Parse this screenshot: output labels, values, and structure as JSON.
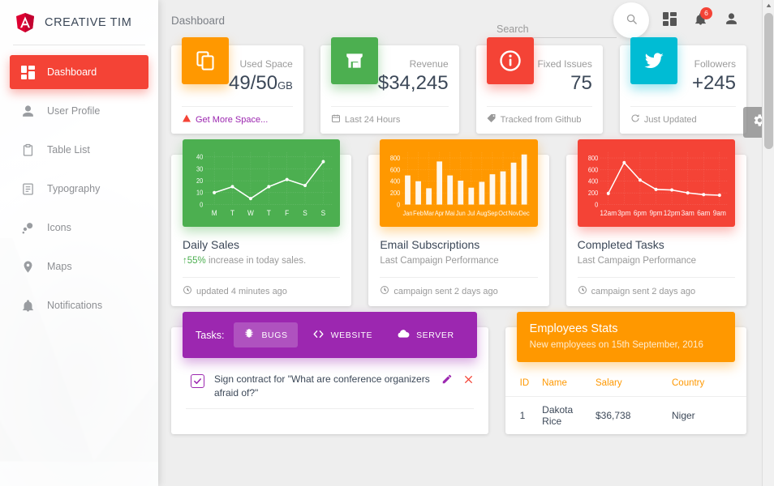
{
  "brand": {
    "name": "CREATIVE TIM",
    "logo_icon": "angular-logo-icon"
  },
  "sidebar": {
    "items": [
      {
        "label": "Dashboard",
        "icon": "dashboard-grid-icon",
        "active": true
      },
      {
        "label": "User Profile",
        "icon": "person-icon",
        "active": false
      },
      {
        "label": "Table List",
        "icon": "clipboard-icon",
        "active": false
      },
      {
        "label": "Typography",
        "icon": "text-document-icon",
        "active": false
      },
      {
        "label": "Icons",
        "icon": "bubbles-icon",
        "active": false
      },
      {
        "label": "Maps",
        "icon": "map-pin-icon",
        "active": false
      },
      {
        "label": "Notifications",
        "icon": "bell-icon",
        "active": false
      }
    ]
  },
  "topbar": {
    "title": "Dashboard",
    "search": {
      "placeholder": "Search",
      "value": ""
    },
    "search_button_icon": "search-icon",
    "dashboard_icon": "dashboard-grid-icon",
    "notifications_icon": "bell-icon",
    "notifications_count": "6",
    "profile_icon": "person-icon"
  },
  "settings_tab": {
    "icon": "gear-icon"
  },
  "stats": [
    {
      "label": "Used Space",
      "value": "49/50",
      "unit": "GB",
      "icon": "copy-layers-icon",
      "color": "#ff9800",
      "footer_text": "Get More Space...",
      "footer_icon": "warning-triangle-icon",
      "footer_is_link": true
    },
    {
      "label": "Revenue",
      "value": "$34,245",
      "unit": "",
      "icon": "store-icon",
      "color": "#4caf50",
      "footer_text": "Last 24 Hours",
      "footer_icon": "calendar-icon",
      "footer_is_link": false
    },
    {
      "label": "Fixed Issues",
      "value": "75",
      "unit": "",
      "icon": "info-circle-icon",
      "color": "#f44336",
      "footer_text": "Tracked from Github",
      "footer_icon": "tag-icon",
      "footer_is_link": false
    },
    {
      "label": "Followers",
      "value": "+245",
      "unit": "",
      "icon": "twitter-bird-icon",
      "color": "#00bcd4",
      "footer_text": "Just Updated",
      "footer_icon": "refresh-icon",
      "footer_is_link": false
    }
  ],
  "charts": [
    {
      "title": "Daily Sales",
      "subtitle_highlight": "55%",
      "subtitle": " increase in today sales.",
      "subtitle_icon": "arrow-up-icon",
      "footer_text": "updated 4 minutes ago",
      "footer_icon": "clock-icon",
      "color": "#4caf50"
    },
    {
      "title": "Email Subscriptions",
      "subtitle_highlight": "",
      "subtitle": "Last Campaign Performance",
      "subtitle_icon": "",
      "footer_text": "campaign sent 2 days ago",
      "footer_icon": "clock-icon",
      "color": "#ff9800"
    },
    {
      "title": "Completed Tasks",
      "subtitle_highlight": "",
      "subtitle": "Last Campaign Performance",
      "subtitle_icon": "",
      "footer_text": "campaign sent 2 days ago",
      "footer_icon": "clock-icon",
      "color": "#f44336"
    }
  ],
  "chart_data": [
    {
      "type": "line",
      "title": "Daily Sales",
      "categories": [
        "M",
        "T",
        "W",
        "T",
        "F",
        "S",
        "S"
      ],
      "values": [
        10,
        15,
        5,
        15,
        21,
        16,
        36
      ],
      "yticks": [
        0,
        10,
        20,
        30,
        40
      ],
      "ylim": [
        0,
        44
      ],
      "xlabel": "",
      "ylabel": "",
      "grid": true,
      "legend": "none",
      "color": "#ffffff",
      "background": "#4caf50"
    },
    {
      "type": "bar",
      "title": "Email Subscriptions",
      "categories": [
        "Jan",
        "Feb",
        "Mar",
        "Apr",
        "Mai",
        "Jun",
        "Jul",
        "Aug",
        "Sep",
        "Oct",
        "Nov",
        "Dec"
      ],
      "values": [
        500,
        400,
        280,
        740,
        500,
        410,
        290,
        390,
        520,
        570,
        720,
        860
      ],
      "yticks": [
        0,
        200,
        400,
        600,
        800
      ],
      "ylim": [
        0,
        900
      ],
      "xlabel": "",
      "ylabel": "",
      "grid": true,
      "legend": "none",
      "color": "#ffffff",
      "background": "#ff9800"
    },
    {
      "type": "line",
      "title": "Completed Tasks",
      "categories": [
        "12am",
        "3pm",
        "6pm",
        "9pm",
        "12pm",
        "3am",
        "6am",
        "9am"
      ],
      "values": [
        190,
        720,
        420,
        260,
        250,
        200,
        170,
        160
      ],
      "yticks": [
        0,
        200,
        400,
        600,
        800
      ],
      "ylim": [
        0,
        900
      ],
      "xlabel": "",
      "ylabel": "",
      "grid": true,
      "legend": "none",
      "color": "#ffffff",
      "background": "#f44336"
    }
  ],
  "tasks_card": {
    "label": "Tasks:",
    "tabs": [
      {
        "label": "BUGS",
        "icon": "bug-icon",
        "active": true
      },
      {
        "label": "WEBSITE",
        "icon": "code-icon",
        "active": false
      },
      {
        "label": "SERVER",
        "icon": "cloud-icon",
        "active": false
      }
    ],
    "rows": [
      {
        "text": "Sign contract for \"What are conference organizers afraid of?\"",
        "checked": true,
        "edit_icon": "pencil-icon",
        "delete_icon": "close-icon"
      }
    ]
  },
  "employees_card": {
    "title": "Employees Stats",
    "subtitle": "New employees on 15th September, 2016",
    "columns": [
      "ID",
      "Name",
      "Salary",
      "Country"
    ],
    "rows": [
      {
        "id": "1",
        "name": "Dakota Rice",
        "salary": "$36,738",
        "country": "Niger"
      }
    ]
  }
}
